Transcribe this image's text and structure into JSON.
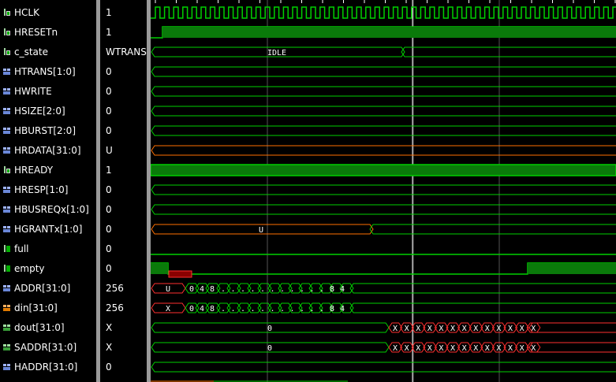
{
  "signals": [
    {
      "name": "HCLK",
      "value": "1",
      "icon": "bit-signal-icon"
    },
    {
      "name": "HRESETn",
      "value": "1",
      "icon": "bit-signal-icon"
    },
    {
      "name": "c_state",
      "value": "WTRANS",
      "icon": "bit-signal-icon"
    },
    {
      "name": "HTRANS[1:0]",
      "value": "0",
      "icon": "bus-signal-icon"
    },
    {
      "name": "HWRITE",
      "value": "0",
      "icon": "bus-signal-icon"
    },
    {
      "name": "HSIZE[2:0]",
      "value": "0",
      "icon": "bus-signal-icon"
    },
    {
      "name": "HBURST[2:0]",
      "value": "0",
      "icon": "bus-signal-icon"
    },
    {
      "name": "HRDATA[31:0]",
      "value": "U",
      "icon": "bus-signal-icon"
    },
    {
      "name": "HREADY",
      "value": "1",
      "icon": "bit-signal-icon"
    },
    {
      "name": "HRESP[1:0]",
      "value": "0",
      "icon": "bus-signal-icon"
    },
    {
      "name": "HBUSREQx[1:0]",
      "value": "0",
      "icon": "bus-signal-icon"
    },
    {
      "name": "HGRANTx[1:0]",
      "value": "0",
      "icon": "bus-signal-icon"
    },
    {
      "name": "full",
      "value": "0",
      "icon": "reg-signal-icon"
    },
    {
      "name": "empty",
      "value": "0",
      "icon": "reg-signal-icon"
    },
    {
      "name": "ADDR[31:0]",
      "value": "256",
      "icon": "bus-signal-icon"
    },
    {
      "name": "din[31:0]",
      "value": "256",
      "icon": "input-bus-icon"
    },
    {
      "name": "dout[31:0]",
      "value": "X",
      "icon": "output-bus-icon"
    },
    {
      "name": "SADDR[31:0]",
      "value": "X",
      "icon": "output-bus-icon"
    },
    {
      "name": "HADDR[31:0]",
      "value": "0",
      "icon": "bus-signal-icon"
    }
  ],
  "waveform_labels": {
    "c_state": "IDLE",
    "HGRANTx": "U",
    "ADDR_initial": "U",
    "din_initial": "X",
    "dout": "0",
    "SADDR": "0",
    "unknown": "X",
    "addr_seq_start": [
      "0",
      "4",
      "8"
    ],
    "addr_seq_end": [
      "8",
      "4"
    ]
  },
  "colors": {
    "wave_green": "#00d000",
    "fill_green": "#0a7a0a",
    "bus_red": "#ff3030",
    "unknown_fill": "#8a0000",
    "orange_bus": "#ff7000",
    "grid": "#555555",
    "cursor": "#ffffff",
    "separator": "#9a9a9a"
  }
}
